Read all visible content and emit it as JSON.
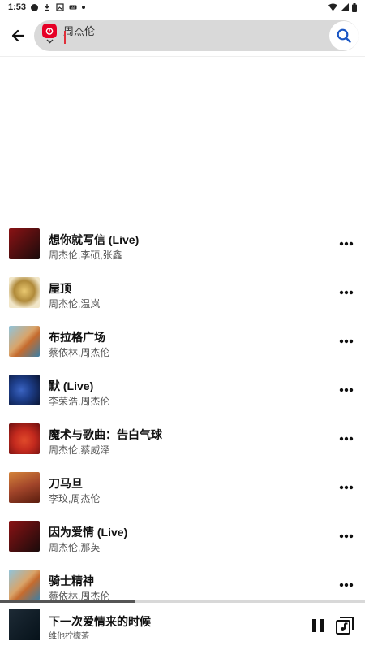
{
  "status_bar": {
    "time": "1:53",
    "left_icons": [
      "circle-notification-icon",
      "download-icon",
      "photo-icon",
      "keyboard-icon",
      "dot-icon"
    ],
    "right_icons": [
      "wifi-icon",
      "signal-icon",
      "battery-icon"
    ]
  },
  "search": {
    "query": "周杰伦",
    "source_icon": "netease-music-logo",
    "back_icon": "arrow-left-icon",
    "submit_icon": "search-icon"
  },
  "results": [
    {
      "title": "想你就写信 (Live)",
      "artists": "周杰伦,李硕,张鑫",
      "cover_colors": [
        "#8a1214",
        "#1a0b0b"
      ]
    },
    {
      "title": "屋顶",
      "artists": "周杰伦,温岚",
      "cover_colors": [
        "#f1e6c8",
        "#b08a3a"
      ]
    },
    {
      "title": "布拉格广场",
      "artists": "蔡依林,周杰伦",
      "cover_colors": [
        "#8fc4dc",
        "#c56b2e"
      ]
    },
    {
      "title": "默 (Live)",
      "artists": "李荣浩,周杰伦",
      "cover_colors": [
        "#1e3f8c",
        "#0a1533"
      ]
    },
    {
      "title": "魔术与歌曲：告白气球",
      "artists": "周杰伦,蔡威泽",
      "cover_colors": [
        "#c42a1e",
        "#6e1010"
      ]
    },
    {
      "title": "刀马旦",
      "artists": "李玟,周杰伦",
      "cover_colors": [
        "#d4843a",
        "#5a1d0e"
      ]
    },
    {
      "title": "因为爱情 (Live)",
      "artists": "周杰伦,那英",
      "cover_colors": [
        "#8a1214",
        "#1a0b0b"
      ]
    },
    {
      "title": "骑士精神",
      "artists": "蔡依林,周杰伦",
      "cover_colors": [
        "#8fc4dc",
        "#c56b2e"
      ]
    }
  ],
  "more_icon": "more-horizontal-icon",
  "player": {
    "title": "下一次爱情来的时候",
    "artist": "维他柠檬茶",
    "progress": 0.37,
    "pause_icon": "pause-icon",
    "playlist_icon": "playlist-icon"
  },
  "colors": {
    "accent": "#e60026",
    "search_pill": "#d9d9d9",
    "search_icon": "#1a56c4"
  }
}
